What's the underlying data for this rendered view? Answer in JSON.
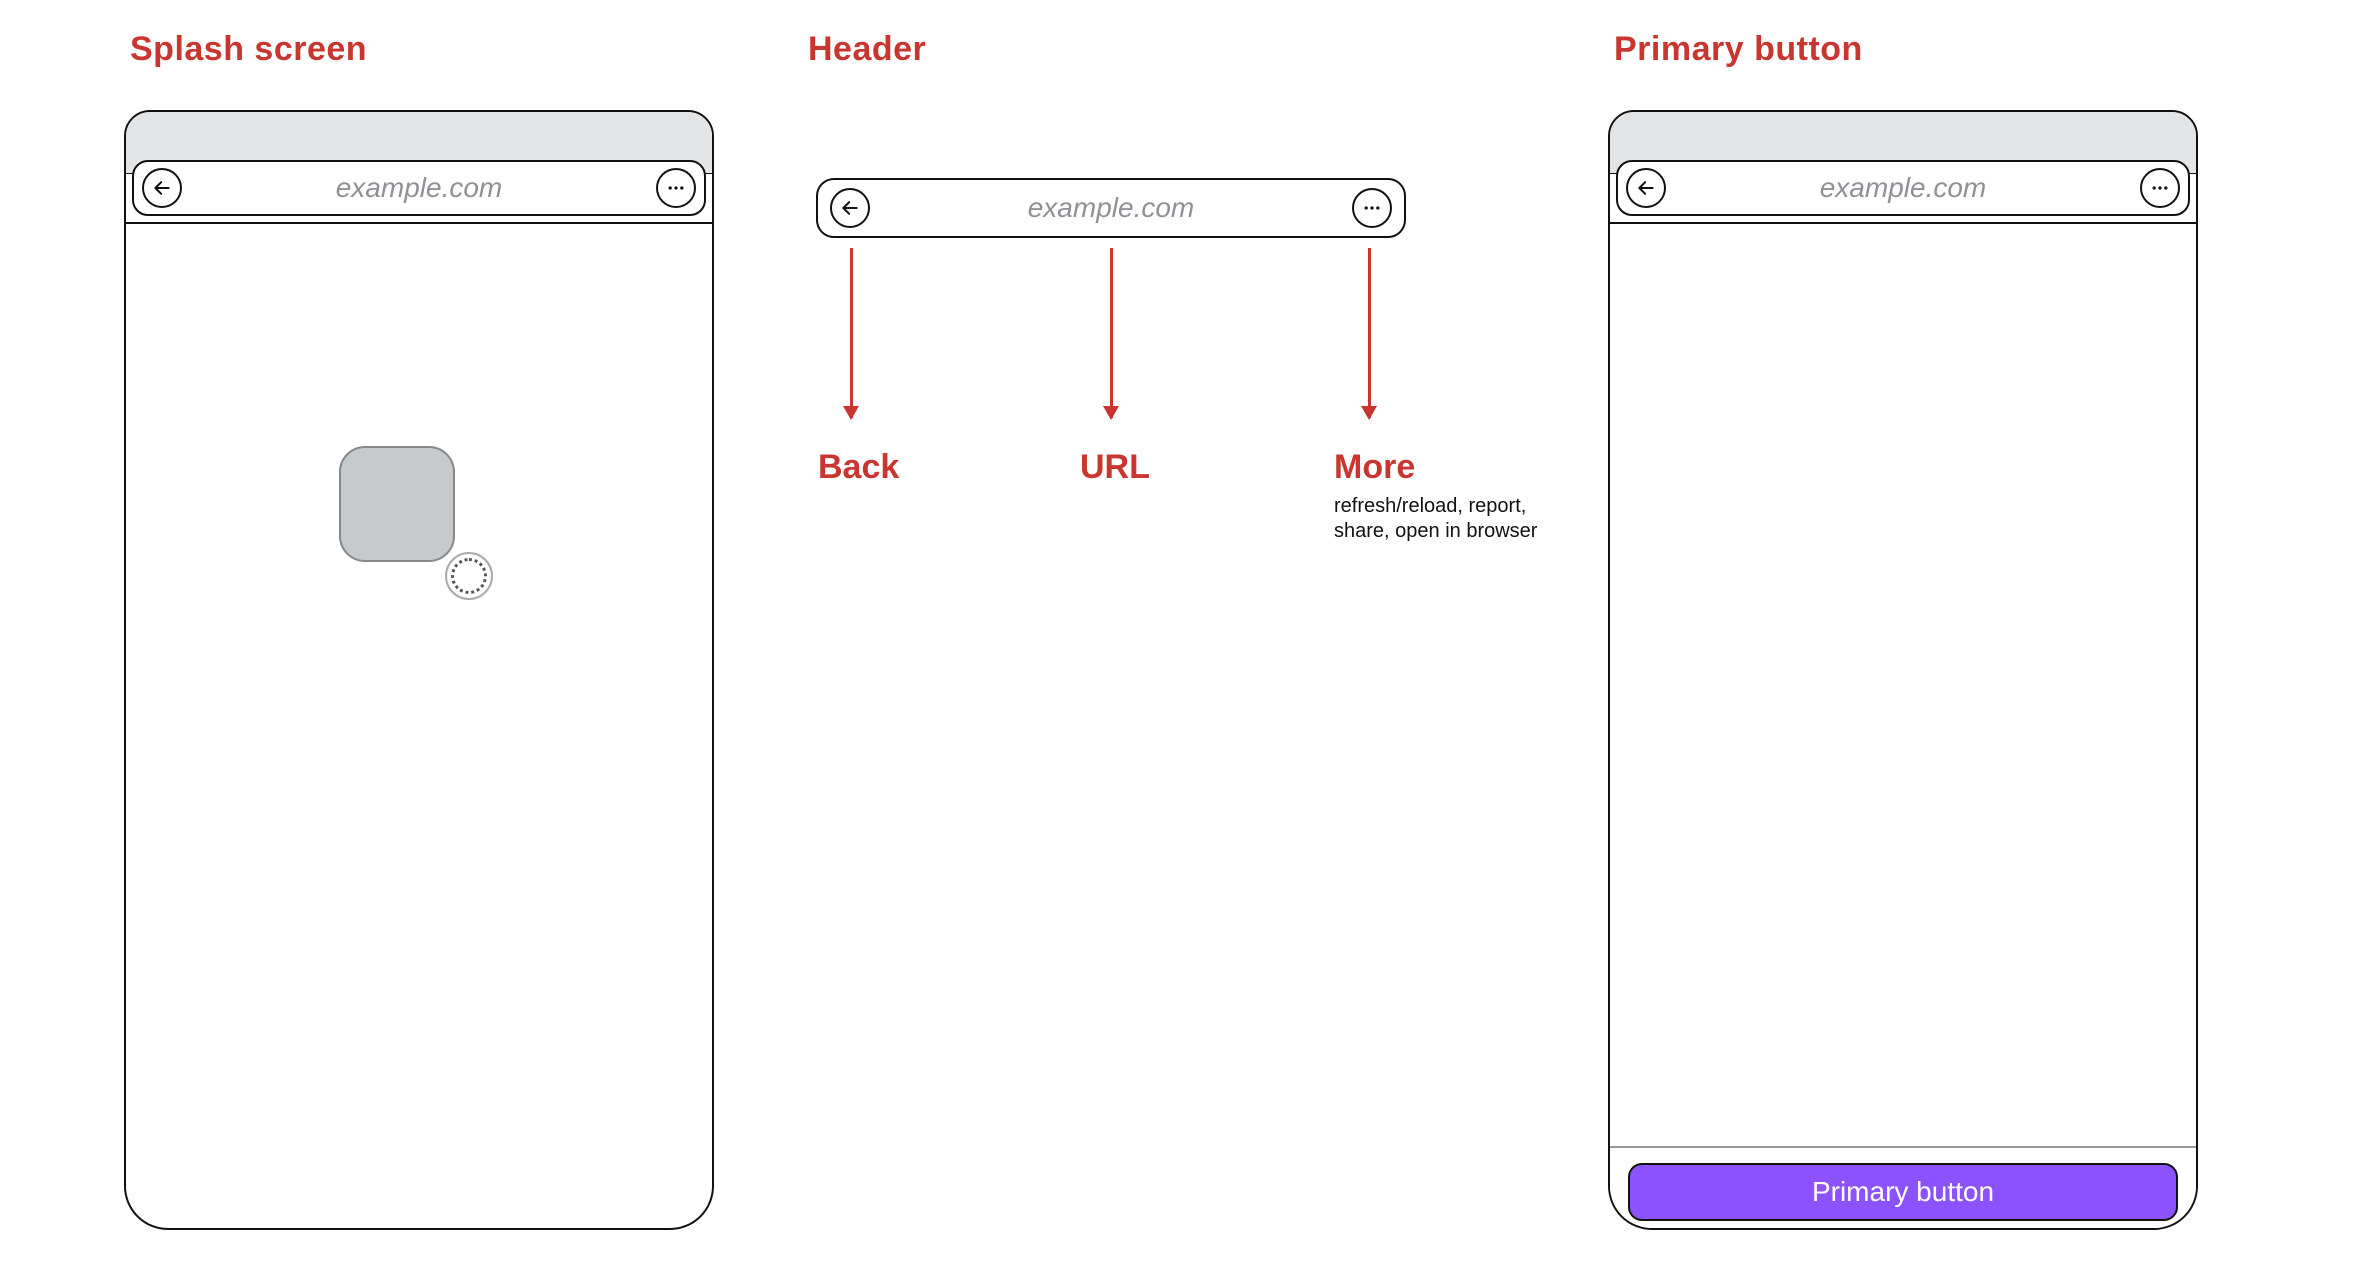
{
  "titles": {
    "splash": "Splash screen",
    "header": "Header",
    "primary": "Primary button"
  },
  "common": {
    "url": "example.com"
  },
  "annotations": {
    "back": "Back",
    "url": "URL",
    "more": "More",
    "more_sub": "refresh/reload, report, share, open in browser"
  },
  "primary_button": {
    "label": "Primary button"
  },
  "colors": {
    "accent_red": "#c8362f",
    "primary_purple": "#8c52ff",
    "status_gray": "#e2e4e6",
    "icon_tile_gray": "#c7cacd"
  }
}
